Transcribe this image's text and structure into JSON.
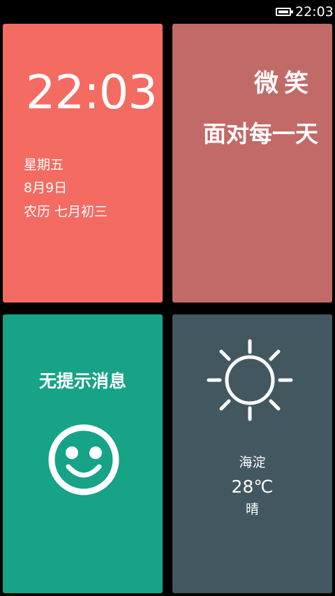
{
  "status_bar": {
    "time": "22:03",
    "battery_icon": "battery-icon"
  },
  "clock_tile": {
    "time": "22:03",
    "weekday": "星期五",
    "date": "8月9日",
    "lunar": "农历 七月初三",
    "color": "#f46b62"
  },
  "quote_tile": {
    "line1": "微笑",
    "line2": "面对每一天",
    "color": "#c26a68"
  },
  "notification_tile": {
    "message": "无提示消息",
    "icon": "smile-icon",
    "color": "#16a386"
  },
  "weather_tile": {
    "location": "海淀",
    "temperature": "28℃",
    "condition": "晴",
    "icon": "sun-icon",
    "color": "#42575f"
  }
}
